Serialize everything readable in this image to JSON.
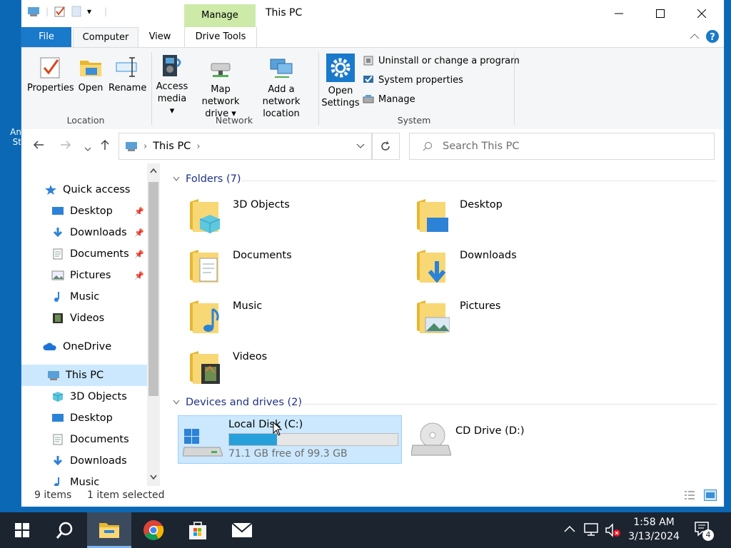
{
  "desktop": {
    "icon_label_lines": [
      "An",
      "St"
    ]
  },
  "window": {
    "title": "This PC",
    "qat_dropdown": "▾"
  },
  "ribbon": {
    "tabs": {
      "file": "File",
      "computer": "Computer",
      "view": "View",
      "drive_tools": "Drive Tools",
      "manage": "Manage"
    },
    "buttons": {
      "properties": "Properties",
      "open": "Open",
      "rename": "Rename",
      "access_media": [
        "Access",
        "media ▾"
      ],
      "map_network_drive": [
        "Map network",
        "drive ▾"
      ],
      "add_network_location": [
        "Add a network",
        "location"
      ],
      "open_settings": [
        "Open",
        "Settings"
      ],
      "uninstall": "Uninstall or change a program",
      "system_properties": "System properties",
      "manage": "Manage"
    },
    "groups": {
      "location": "Location",
      "network": "Network",
      "system": "System"
    }
  },
  "address": {
    "crumb": "This PC",
    "search_placeholder": "Search This PC"
  },
  "nav": {
    "quick_access": "Quick access",
    "quick_items": [
      "Desktop",
      "Downloads",
      "Documents",
      "Pictures",
      "Music",
      "Videos"
    ],
    "onedrive": "OneDrive",
    "this_pc": "This PC",
    "pc_items": [
      "3D Objects",
      "Desktop",
      "Documents",
      "Downloads",
      "Music"
    ]
  },
  "content": {
    "folders_header": "Folders (7)",
    "folders": [
      "3D Objects",
      "Desktop",
      "Documents",
      "Downloads",
      "Music",
      "Pictures",
      "Videos"
    ],
    "devices_header": "Devices and drives (2)",
    "drive_c": {
      "name": "Local Disk (C:)",
      "free_text": "71.1 GB free of 99.3 GB",
      "used_fraction": 0.284
    },
    "drive_d": {
      "name": "CD Drive (D:)"
    }
  },
  "status": {
    "items": "9 items",
    "selected": "1 item selected"
  },
  "taskbar": {
    "time": "1:58 AM",
    "date": "3/13/2024",
    "notifications": "4"
  },
  "colors": {
    "accent": "#1979ca",
    "selection": "#cce8ff",
    "manage_tab": "#cdeaa8",
    "taskbar": "#1c2430",
    "progress": "#26a0da",
    "folder": "#f8d775"
  }
}
